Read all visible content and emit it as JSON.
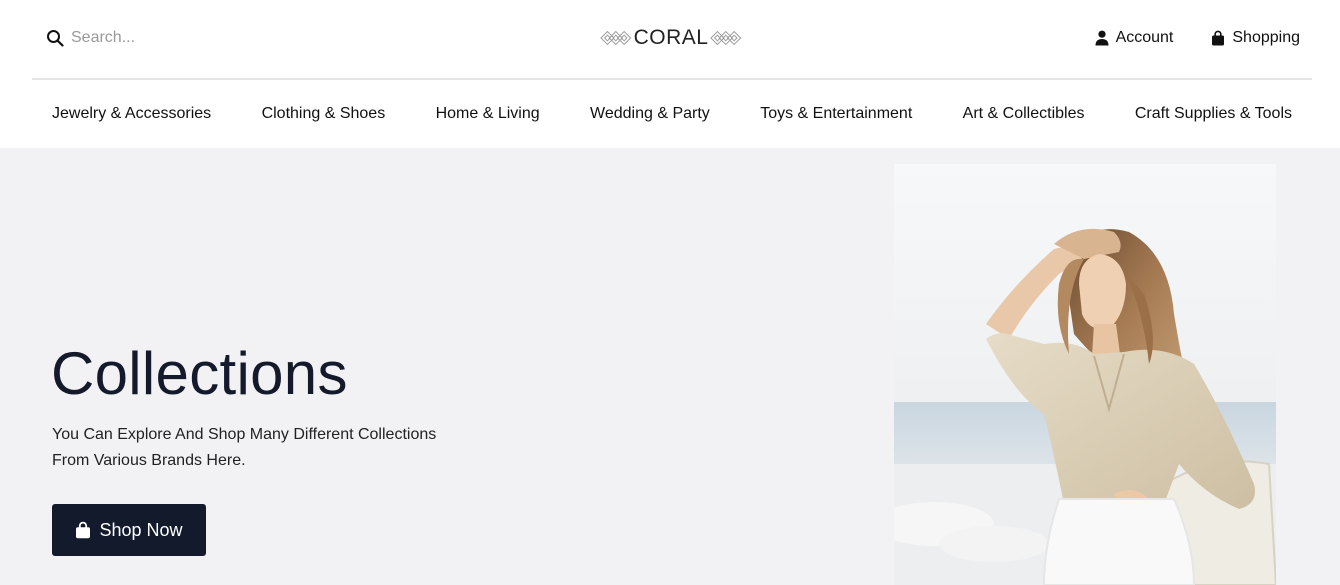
{
  "header": {
    "search": {
      "placeholder": "Search...",
      "icon": "search-icon"
    },
    "logo": {
      "text": "CORAL",
      "icon": "diamond-pattern-icon"
    },
    "actions": [
      {
        "label": "Account",
        "icon": "user-icon"
      },
      {
        "label": "Shopping",
        "icon": "shopping-bag-icon"
      }
    ]
  },
  "nav": {
    "items": [
      "Jewelry & Accessories",
      "Clothing & Shoes",
      "Home & Living",
      "Wedding & Party",
      "Toys & Entertainment",
      "Art & Collectibles",
      "Craft Supplies & Tools"
    ]
  },
  "hero": {
    "title": "Collections",
    "subtitle_line1": "You Can Explore And Shop Many Different Collections",
    "subtitle_line2": "From Various Brands Here.",
    "button_label": "Shop Now",
    "button_icon": "shopping-bag-icon",
    "image": "woman-in-beige-blouse-photo"
  },
  "colors": {
    "accent": "#121a2c",
    "hero_bg": "#f2f2f4",
    "divider": "#e5e5e5"
  }
}
